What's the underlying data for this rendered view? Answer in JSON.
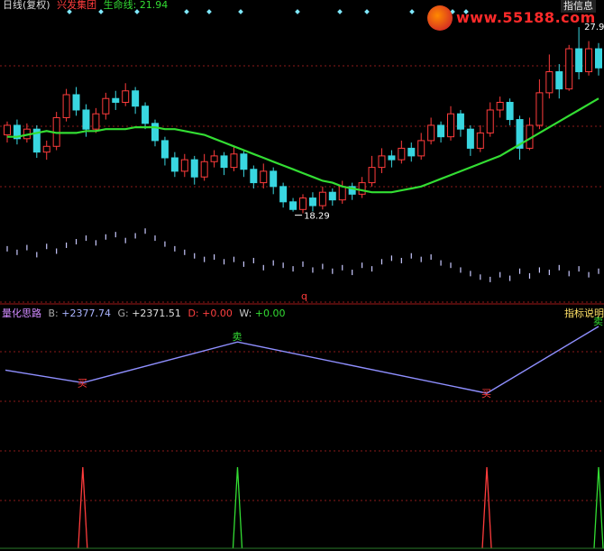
{
  "header": {
    "period": "日线(复权)",
    "stock_name": "兴发集团",
    "ma_label": "生命线",
    "ma_value": "21.94"
  },
  "watermark": {
    "site": "www.55188.com",
    "badge": "指信息"
  },
  "indicator_header": {
    "name": "量化思路",
    "b_label": "B:",
    "b_value": "+2377.74",
    "g_label": "G:",
    "g_value": "+2371.51",
    "d_label": "D:",
    "d_value": "+0.00",
    "w_label": "W:",
    "w_value": "+0.00",
    "doc_link": "指标说明"
  },
  "colors": {
    "up": "#ff3c3c",
    "down": "#39d6e0",
    "ma": "#33dd33",
    "grid": "#8b1a1a",
    "signal_line": "#8f8fff",
    "buy": "#ff3c3c",
    "sell": "#33dd33"
  },
  "chart_data": [
    {
      "type": "candlestick",
      "title": "兴发集团",
      "annotations": [
        {
          "text": "27.93",
          "kind": "high"
        },
        {
          "text": "18.29",
          "kind": "low"
        },
        {
          "text": "q",
          "kind": "marker"
        }
      ],
      "ylim": [
        17.0,
        28.5
      ],
      "series": [
        {
          "name": "生命线",
          "values": [
            22.2,
            22.2,
            22.3,
            22.4,
            22.5,
            22.4,
            22.4,
            22.4,
            22.5,
            22.5,
            22.6,
            22.6,
            22.6,
            22.7,
            22.7,
            22.7,
            22.6,
            22.6,
            22.5,
            22.4,
            22.3,
            22.1,
            21.9,
            21.7,
            21.5,
            21.3,
            21.1,
            20.9,
            20.7,
            20.5,
            20.3,
            20.1,
            19.9,
            19.8,
            19.6,
            19.5,
            19.4,
            19.3,
            19.3,
            19.3,
            19.4,
            19.5,
            19.6,
            19.8,
            20.0,
            20.2,
            20.4,
            20.6,
            20.8,
            21.0,
            21.2,
            21.5,
            21.8,
            22.1,
            22.4,
            22.7,
            23.0,
            23.3,
            23.6,
            23.9,
            24.2
          ]
        }
      ],
      "candles": [
        [
          22.3,
          22.8,
          21.9,
          23.0
        ],
        [
          22.8,
          22.1,
          21.8,
          23.1
        ],
        [
          22.1,
          22.6,
          21.9,
          22.9
        ],
        [
          22.6,
          21.4,
          21.1,
          22.8
        ],
        [
          21.4,
          21.7,
          21.0,
          22.0
        ],
        [
          21.7,
          23.2,
          21.5,
          23.5
        ],
        [
          23.2,
          24.4,
          23.0,
          24.7
        ],
        [
          24.4,
          23.6,
          23.3,
          24.8
        ],
        [
          23.6,
          22.6,
          22.2,
          23.9
        ],
        [
          22.6,
          23.4,
          22.4,
          23.7
        ],
        [
          23.4,
          24.2,
          23.1,
          24.5
        ],
        [
          24.2,
          24.0,
          23.6,
          24.6
        ],
        [
          24.0,
          24.6,
          23.8,
          25.0
        ],
        [
          24.6,
          23.8,
          23.4,
          24.8
        ],
        [
          23.8,
          22.9,
          22.6,
          24.0
        ],
        [
          22.9,
          22.0,
          21.7,
          23.1
        ],
        [
          22.0,
          21.1,
          20.7,
          22.2
        ],
        [
          21.1,
          20.4,
          20.1,
          21.4
        ],
        [
          20.4,
          21.0,
          20.1,
          21.3
        ],
        [
          21.0,
          20.1,
          19.7,
          21.2
        ],
        [
          20.1,
          20.9,
          19.9,
          21.3
        ],
        [
          20.9,
          21.2,
          20.6,
          21.5
        ],
        [
          21.2,
          20.6,
          20.2,
          21.4
        ],
        [
          20.6,
          21.3,
          20.4,
          21.7
        ],
        [
          21.3,
          20.5,
          20.1,
          21.5
        ],
        [
          20.5,
          19.8,
          19.5,
          20.7
        ],
        [
          19.8,
          20.4,
          19.5,
          20.8
        ],
        [
          20.4,
          19.6,
          19.2,
          20.6
        ],
        [
          19.6,
          18.8,
          18.5,
          19.8
        ],
        [
          18.8,
          18.4,
          18.29,
          19.0
        ],
        [
          18.4,
          19.0,
          18.2,
          19.2
        ],
        [
          19.0,
          18.6,
          18.3,
          19.3
        ],
        [
          18.6,
          19.3,
          18.4,
          19.6
        ],
        [
          19.3,
          18.9,
          18.6,
          19.5
        ],
        [
          18.9,
          19.6,
          18.7,
          19.9
        ],
        [
          19.6,
          19.2,
          18.9,
          19.8
        ],
        [
          19.2,
          19.8,
          19.0,
          20.1
        ],
        [
          19.8,
          20.6,
          19.6,
          21.2
        ],
        [
          20.6,
          21.2,
          20.3,
          21.6
        ],
        [
          21.2,
          21.0,
          20.6,
          21.5
        ],
        [
          21.0,
          21.6,
          20.8,
          22.0
        ],
        [
          21.6,
          21.2,
          20.9,
          21.9
        ],
        [
          21.2,
          22.0,
          21.0,
          22.4
        ],
        [
          22.0,
          22.8,
          21.8,
          23.2
        ],
        [
          22.8,
          22.2,
          21.9,
          23.0
        ],
        [
          22.2,
          23.4,
          22.0,
          23.8
        ],
        [
          23.4,
          22.6,
          22.2,
          23.6
        ],
        [
          22.6,
          21.6,
          21.2,
          22.8
        ],
        [
          21.6,
          22.4,
          21.4,
          22.8
        ],
        [
          22.4,
          23.6,
          22.2,
          24.0
        ],
        [
          23.6,
          24.0,
          23.2,
          24.3
        ],
        [
          24.0,
          23.1,
          22.8,
          24.2
        ],
        [
          23.1,
          21.6,
          21.0,
          23.3
        ],
        [
          21.6,
          22.8,
          21.5,
          23.2
        ],
        [
          22.8,
          24.5,
          22.6,
          25.2
        ],
        [
          24.5,
          25.6,
          24.2,
          26.5
        ],
        [
          25.6,
          24.7,
          24.2,
          26.0
        ],
        [
          24.7,
          26.8,
          24.6,
          27.0
        ],
        [
          26.8,
          25.6,
          25.2,
          27.93
        ],
        [
          25.6,
          26.8,
          25.4,
          27.2
        ],
        [
          26.8,
          25.8,
          25.4,
          27.1
        ]
      ],
      "volume": [
        36,
        33,
        37,
        31,
        38,
        34,
        39,
        42,
        45,
        41,
        46,
        48,
        43,
        47,
        51,
        45,
        40,
        36,
        33,
        30,
        27,
        29,
        25,
        27,
        23,
        26,
        20,
        24,
        22,
        19,
        23,
        18,
        21,
        17,
        20,
        16,
        22,
        19,
        25,
        28,
        26,
        30,
        27,
        29,
        24,
        22,
        18,
        15,
        12,
        10,
        14,
        11,
        17,
        13,
        18,
        16,
        20,
        15,
        19,
        14,
        17
      ],
      "volume_ylim": [
        0,
        55
      ]
    },
    {
      "type": "line",
      "title": "量化思路",
      "x": [
        0,
        9,
        27,
        56,
        69
      ],
      "values": [
        0.38,
        0.2,
        0.78,
        0.05,
        1.0
      ],
      "labels": [
        {
          "text": "买",
          "kind": "buy",
          "index": 1
        },
        {
          "text": "卖",
          "kind": "sell",
          "index": 2
        },
        {
          "text": "买",
          "kind": "buy",
          "index": 3
        },
        {
          "text": "卖",
          "kind": "sell",
          "index": 4
        }
      ],
      "spikes": [
        {
          "index": 9,
          "kind": "buy"
        },
        {
          "index": 27,
          "kind": "sell"
        },
        {
          "index": 56,
          "kind": "buy"
        },
        {
          "index": 69,
          "kind": "sell"
        }
      ],
      "xlim": [
        0,
        69
      ],
      "ylim": [
        0,
        1
      ]
    }
  ]
}
